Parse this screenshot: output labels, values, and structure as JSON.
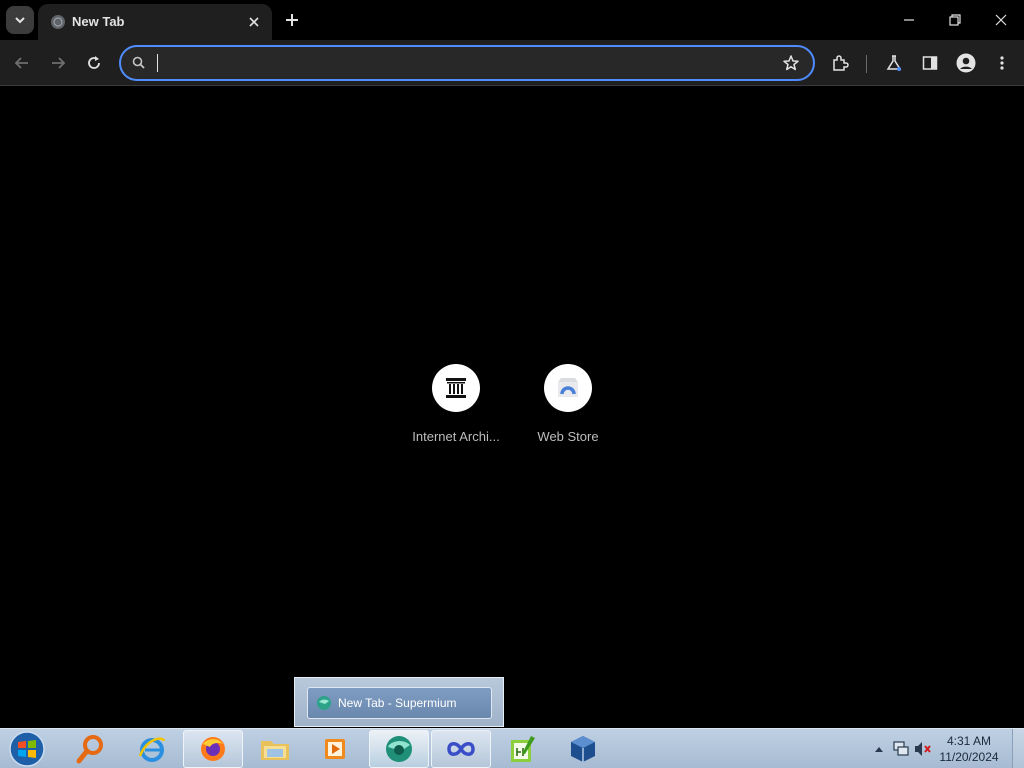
{
  "tab": {
    "title": "New Tab"
  },
  "omnibox": {
    "value": "",
    "placeholder": ""
  },
  "shortcuts": [
    {
      "label": "Internet Archi..."
    },
    {
      "label": "Web Store"
    }
  ],
  "taskbar": {
    "thumbnail_label": "New Tab - Supermium",
    "clock_time": "4:31 AM",
    "clock_date": "11/20/2024"
  },
  "colors": {
    "omnibox_focus": "#4f8cff",
    "toolbar_bg": "#1f1f1f",
    "page_bg": "#000000"
  },
  "icons": [
    "chevron-down-icon",
    "globe-icon",
    "close-icon",
    "plus-icon",
    "minimize-icon",
    "restore-icon",
    "back-icon",
    "forward-icon",
    "reload-icon",
    "search-icon",
    "star-icon",
    "extensions-icon",
    "flask-icon",
    "side-panel-icon",
    "profile-icon",
    "kebab-menu-icon",
    "archive-building-icon",
    "web-store-icon",
    "windows-start-icon",
    "magnifier-app-icon",
    "ie-icon",
    "firefox-icon",
    "folder-icon",
    "media-player-icon",
    "supermium-icon",
    "infinity-app-icon",
    "notepad-plus-icon",
    "virtualbox-icon",
    "tray-arrow-icon",
    "network-icon",
    "volume-muted-icon"
  ]
}
